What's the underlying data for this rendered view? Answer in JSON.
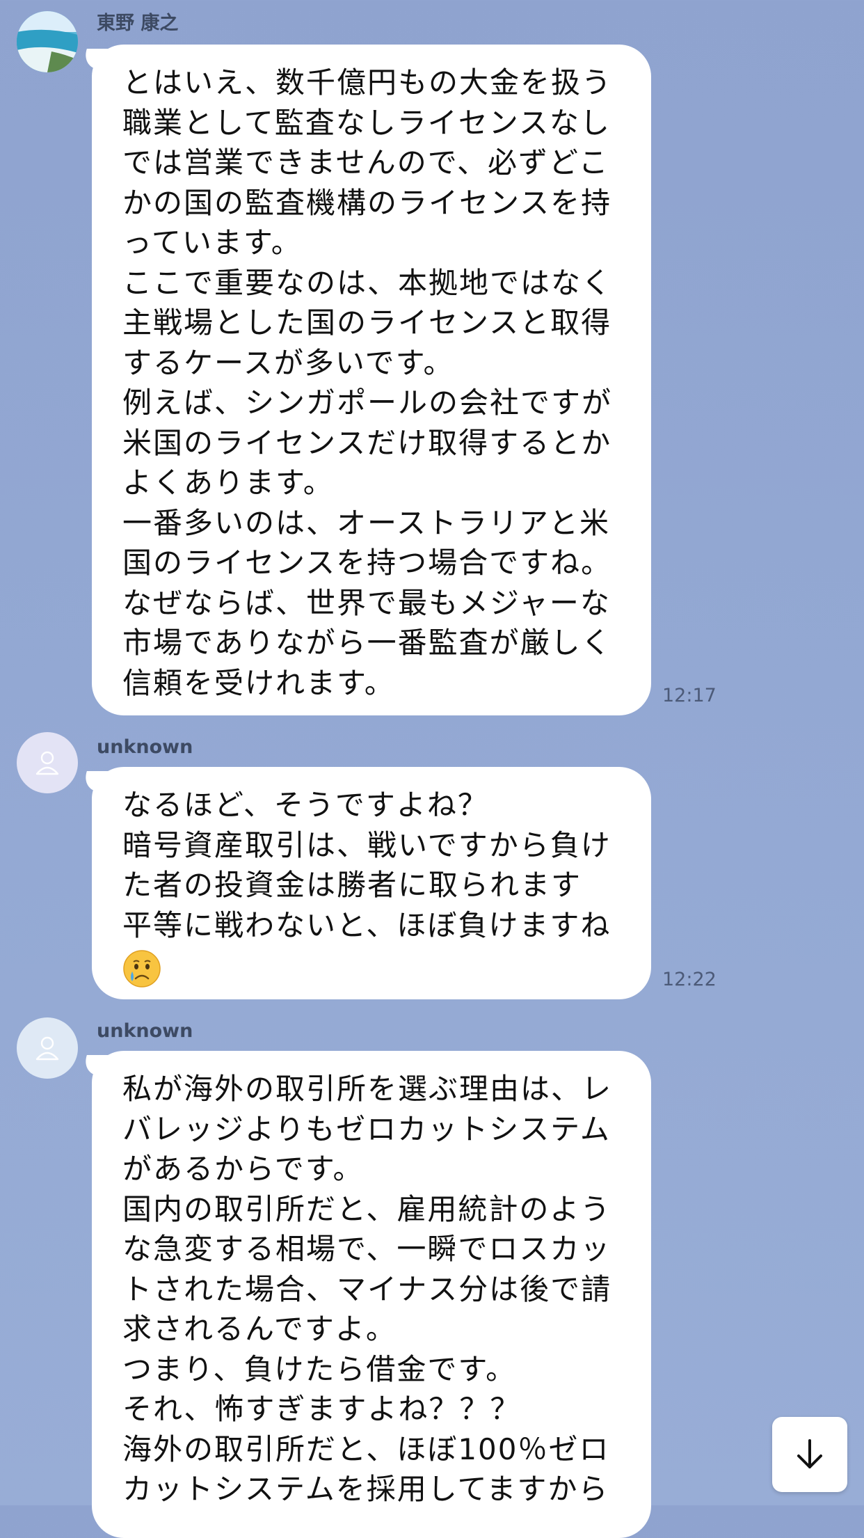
{
  "messages": [
    {
      "sender": "東野 康之",
      "text": "とはいえ、数千億円もの大金を扱う\n職業として監査なしライセンスなし\nでは営業できませんので、必ずどこ\nかの国の監査機構のライセンスを持\nっています。\nここで重要なのは、本拠地ではなく\n主戦場とした国のライセンスと取得\nするケースが多いです。\n例えば、シンガポールの会社ですが\n米国のライセンスだけ取得するとか\nよくあります。\n一番多いのは、オーストラリアと米\n国のライセンスを持つ場合ですね。\nなぜならば、世界で最もメジャーな\n市場でありながら一番監査が厳しく\n信頼を受けれます。",
      "time": "12:17",
      "avatar": "photo-avatar"
    },
    {
      "sender": "unknown",
      "text": "なるほど、そうですよね？\n暗号資産取引は、戦いですから負け\nた者の投資金は勝者に取られます\n平等に戦わないと、ほぼ負けますね\n",
      "emoji": "crying-face-emoji",
      "time": "12:22",
      "avatar": "default-person-avatar",
      "avatar_color": "#e3e3f5"
    },
    {
      "sender": "unknown",
      "text": "私が海外の取引所を選ぶ理由は、レ\nバレッジよりもゼロカットシステム\nがあるからです。\n国内の取引所だと、雇用統計のよう\nな急変する相場で、一瞬でロスカッ\nトされた場合、マイナス分は後で請\n求されるんですよ。\nつまり、負けたら借金です。\nそれ、怖すぎますよね？？？\n海外の取引所だと、ほぼ100％ゼロ\nカットシステムを採用してますから",
      "avatar": "default-person-avatar",
      "avatar_color": "#dfe9f5"
    }
  ],
  "scroll_button": {
    "icon": "arrow-down-icon"
  },
  "colors": {
    "background": "#93a8d3",
    "bubble": "#ffffff",
    "name_text": "#3d4a63",
    "time_text": "#4c5a78"
  }
}
